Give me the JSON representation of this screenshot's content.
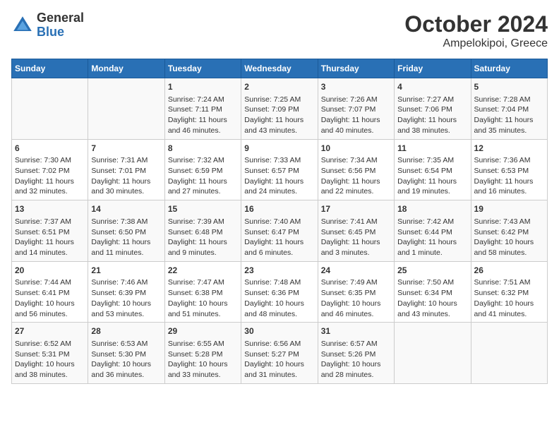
{
  "header": {
    "logo_line1": "General",
    "logo_line2": "Blue",
    "month_year": "October 2024",
    "location": "Ampelokipoi, Greece"
  },
  "weekdays": [
    "Sunday",
    "Monday",
    "Tuesday",
    "Wednesday",
    "Thursday",
    "Friday",
    "Saturday"
  ],
  "weeks": [
    [
      {
        "day": "",
        "content": ""
      },
      {
        "day": "",
        "content": ""
      },
      {
        "day": "1",
        "content": "Sunrise: 7:24 AM\nSunset: 7:11 PM\nDaylight: 11 hours and 46 minutes."
      },
      {
        "day": "2",
        "content": "Sunrise: 7:25 AM\nSunset: 7:09 PM\nDaylight: 11 hours and 43 minutes."
      },
      {
        "day": "3",
        "content": "Sunrise: 7:26 AM\nSunset: 7:07 PM\nDaylight: 11 hours and 40 minutes."
      },
      {
        "day": "4",
        "content": "Sunrise: 7:27 AM\nSunset: 7:06 PM\nDaylight: 11 hours and 38 minutes."
      },
      {
        "day": "5",
        "content": "Sunrise: 7:28 AM\nSunset: 7:04 PM\nDaylight: 11 hours and 35 minutes."
      }
    ],
    [
      {
        "day": "6",
        "content": "Sunrise: 7:30 AM\nSunset: 7:02 PM\nDaylight: 11 hours and 32 minutes."
      },
      {
        "day": "7",
        "content": "Sunrise: 7:31 AM\nSunset: 7:01 PM\nDaylight: 11 hours and 30 minutes."
      },
      {
        "day": "8",
        "content": "Sunrise: 7:32 AM\nSunset: 6:59 PM\nDaylight: 11 hours and 27 minutes."
      },
      {
        "day": "9",
        "content": "Sunrise: 7:33 AM\nSunset: 6:57 PM\nDaylight: 11 hours and 24 minutes."
      },
      {
        "day": "10",
        "content": "Sunrise: 7:34 AM\nSunset: 6:56 PM\nDaylight: 11 hours and 22 minutes."
      },
      {
        "day": "11",
        "content": "Sunrise: 7:35 AM\nSunset: 6:54 PM\nDaylight: 11 hours and 19 minutes."
      },
      {
        "day": "12",
        "content": "Sunrise: 7:36 AM\nSunset: 6:53 PM\nDaylight: 11 hours and 16 minutes."
      }
    ],
    [
      {
        "day": "13",
        "content": "Sunrise: 7:37 AM\nSunset: 6:51 PM\nDaylight: 11 hours and 14 minutes."
      },
      {
        "day": "14",
        "content": "Sunrise: 7:38 AM\nSunset: 6:50 PM\nDaylight: 11 hours and 11 minutes."
      },
      {
        "day": "15",
        "content": "Sunrise: 7:39 AM\nSunset: 6:48 PM\nDaylight: 11 hours and 9 minutes."
      },
      {
        "day": "16",
        "content": "Sunrise: 7:40 AM\nSunset: 6:47 PM\nDaylight: 11 hours and 6 minutes."
      },
      {
        "day": "17",
        "content": "Sunrise: 7:41 AM\nSunset: 6:45 PM\nDaylight: 11 hours and 3 minutes."
      },
      {
        "day": "18",
        "content": "Sunrise: 7:42 AM\nSunset: 6:44 PM\nDaylight: 11 hours and 1 minute."
      },
      {
        "day": "19",
        "content": "Sunrise: 7:43 AM\nSunset: 6:42 PM\nDaylight: 10 hours and 58 minutes."
      }
    ],
    [
      {
        "day": "20",
        "content": "Sunrise: 7:44 AM\nSunset: 6:41 PM\nDaylight: 10 hours and 56 minutes."
      },
      {
        "day": "21",
        "content": "Sunrise: 7:46 AM\nSunset: 6:39 PM\nDaylight: 10 hours and 53 minutes."
      },
      {
        "day": "22",
        "content": "Sunrise: 7:47 AM\nSunset: 6:38 PM\nDaylight: 10 hours and 51 minutes."
      },
      {
        "day": "23",
        "content": "Sunrise: 7:48 AM\nSunset: 6:36 PM\nDaylight: 10 hours and 48 minutes."
      },
      {
        "day": "24",
        "content": "Sunrise: 7:49 AM\nSunset: 6:35 PM\nDaylight: 10 hours and 46 minutes."
      },
      {
        "day": "25",
        "content": "Sunrise: 7:50 AM\nSunset: 6:34 PM\nDaylight: 10 hours and 43 minutes."
      },
      {
        "day": "26",
        "content": "Sunrise: 7:51 AM\nSunset: 6:32 PM\nDaylight: 10 hours and 41 minutes."
      }
    ],
    [
      {
        "day": "27",
        "content": "Sunrise: 6:52 AM\nSunset: 5:31 PM\nDaylight: 10 hours and 38 minutes."
      },
      {
        "day": "28",
        "content": "Sunrise: 6:53 AM\nSunset: 5:30 PM\nDaylight: 10 hours and 36 minutes."
      },
      {
        "day": "29",
        "content": "Sunrise: 6:55 AM\nSunset: 5:28 PM\nDaylight: 10 hours and 33 minutes."
      },
      {
        "day": "30",
        "content": "Sunrise: 6:56 AM\nSunset: 5:27 PM\nDaylight: 10 hours and 31 minutes."
      },
      {
        "day": "31",
        "content": "Sunrise: 6:57 AM\nSunset: 5:26 PM\nDaylight: 10 hours and 28 minutes."
      },
      {
        "day": "",
        "content": ""
      },
      {
        "day": "",
        "content": ""
      }
    ]
  ]
}
